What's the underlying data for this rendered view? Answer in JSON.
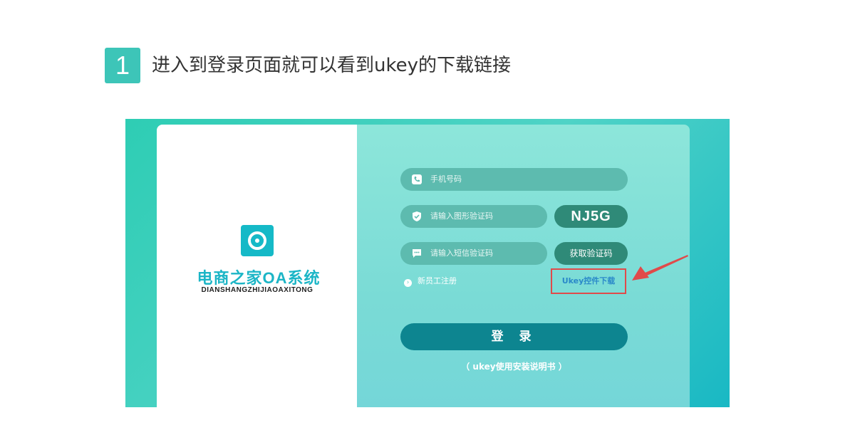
{
  "step": {
    "number": "1",
    "title": "进入到登录页面就可以看到ukey的下载链接"
  },
  "logo": {
    "cn": "电商之家OA系统",
    "en": "DIANSHANGZHIJIAOAXITONG"
  },
  "form": {
    "phone_placeholder": "手机号码",
    "image_code_placeholder": "请输入图形验证码",
    "captcha_text": "NJ5G",
    "sms_code_placeholder": "请输入短信验证码",
    "get_code_label": "获取验证码",
    "register_label": "新员工注册",
    "ukey_download_label": "Ukey控件下载",
    "login_label": "登 录",
    "manual_label": "（ ukey使用安装说明书 ）"
  },
  "colors": {
    "accent": "#3dc5b8",
    "field_bg": "#5dbbaf",
    "login_btn": "#0d8590",
    "highlight_border": "#e04a4a",
    "arrow": "#e04a4a"
  },
  "icons": [
    "phone-icon",
    "shield-check-icon",
    "chat-icon",
    "chevron-right-icon",
    "logo-icon",
    "arrow-icon"
  ]
}
